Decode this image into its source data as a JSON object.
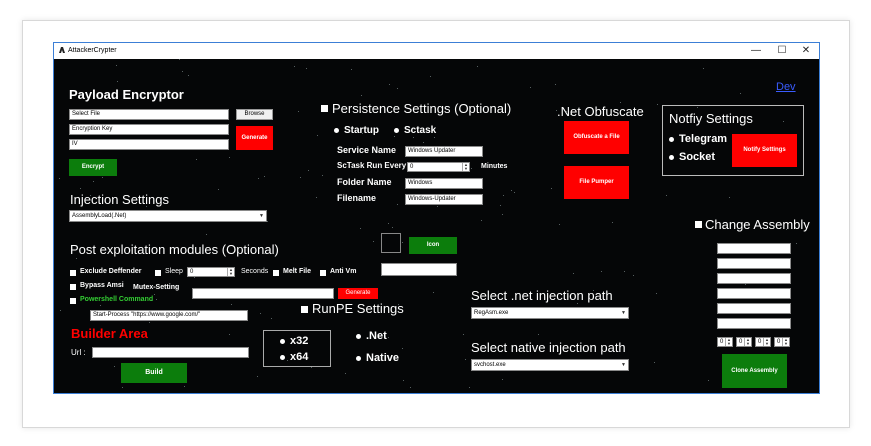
{
  "window": {
    "title": "AttackerCrypter",
    "minimize_glyph": "—",
    "maximize_glyph": "☐",
    "close_glyph": "✕"
  },
  "dev_link": "Dev",
  "payload": {
    "heading": "Payload Encryptor",
    "file_value": "Select File",
    "key_value": "Encryption Key",
    "iv_value": "IV",
    "browse_label": "Browse",
    "generate_label": "Generate",
    "encrypt_label": "Encrypt"
  },
  "injection": {
    "heading": "Injection Settings",
    "selected": "AssemblyLoad(.Net)"
  },
  "post_exploit": {
    "heading": "Post exploitation modules (Optional)",
    "exclude_defender": "Exclude Deffender",
    "sleep": "Sleep",
    "sleep_value": "0",
    "seconds": "Seconds",
    "melt_file": "Melt File",
    "anti_vm": "Anti Vm",
    "bypass_amsi": "Bypass Amsi",
    "mutex_setting": "Mutex-Setting",
    "generate_label": "Generate",
    "powershell_command": "Powershell Command",
    "powershell_value": "Start-Process \"https://www.google.com/\""
  },
  "builder": {
    "heading": "Builder Area",
    "url_label": "Url :",
    "build_label": "Build"
  },
  "persistence": {
    "heading": "Persistence Settings (Optional)",
    "startup": "Startup",
    "sctask": "Sctask",
    "service_name_label": "Service Name",
    "service_name_value": "Windows Updater",
    "sctask_run_label": "ScTask Run Every",
    "sctask_run_value": "0",
    "minutes": "Minutes",
    "folder_name_label": "Folder Name",
    "folder_name_value": "Windows",
    "filename_label": "Filename",
    "filename_value": "Windows-Updater"
  },
  "icon": {
    "label": "Icon"
  },
  "runpe": {
    "heading": "RunPE Settings",
    "x32": "x32",
    "x64": "x64",
    "net": ".Net",
    "native": "Native"
  },
  "net_obfuscate": {
    "heading": ".Net Obfuscate",
    "obfuscate_label": "Obfuscate a File",
    "pumper_label": "File Pumper"
  },
  "injection_path": {
    "net_heading": "Select .net injection path",
    "net_selected": "RegAsm.exe",
    "native_heading": "Select native injection path",
    "native_selected": "svchost.exe"
  },
  "notify": {
    "heading": "Notfiy Settings",
    "telegram": "Telegram",
    "socket": "Socket",
    "button_label": "Notify Settings"
  },
  "change_assembly": {
    "heading": "Change Assembly",
    "version_values": [
      "0",
      "0",
      "0",
      "0"
    ],
    "clone_label": "Clone Assembly"
  },
  "colors": {
    "accent_red": "#ff0000",
    "accent_green": "#0c7d0c",
    "link_blue": "#3a5cff",
    "background": "#050607"
  }
}
